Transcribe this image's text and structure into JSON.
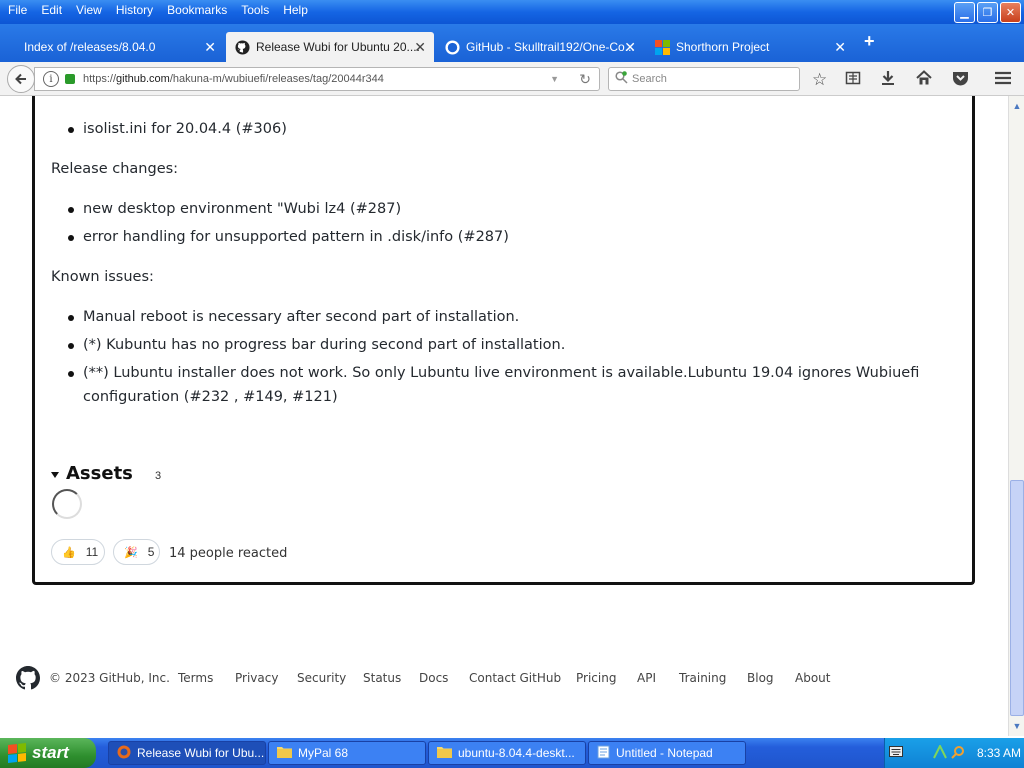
{
  "menu": [
    "File",
    "Edit",
    "View",
    "History",
    "Bookmarks",
    "Tools",
    "Help"
  ],
  "tabs": [
    {
      "title": "Index of /releases/8.04.0"
    },
    {
      "title": "Release Wubi for Ubuntu 20...."
    },
    {
      "title": "GitHub - Skulltrail192/One-Co..."
    },
    {
      "title": "Shorthorn Project"
    }
  ],
  "address": {
    "prefix": "https://",
    "domain": "github.com",
    "path": "/hakuna-m/wubiuefi/releases/tag/20044r344"
  },
  "search": {
    "placeholder": "Search"
  },
  "release": {
    "bullet_top": "isolist.ini for 20.04.4 (#306)",
    "changes_heading": "Release changes:",
    "changes": [
      "new desktop environment \"Wubi lz4 (#287)",
      "error handling for unsupported pattern in .disk/info (#287)"
    ],
    "issues_heading": "Known issues:",
    "issues": [
      "Manual reboot is necessary after second part of installation.",
      "(*) Kubuntu has no progress bar during second part of installation.",
      "(**) Lubuntu installer does not work. So only Lubuntu live environment is available.Lubuntu 19.04 ignores Wubiuefi",
      "configuration (#232 , #149, #121)"
    ]
  },
  "assets": {
    "title": "Assets",
    "count": "3"
  },
  "reactions": {
    "thumbs_count": "11",
    "hooray_count": "5",
    "summary": "14 people reacted"
  },
  "footer": {
    "copyright": "© 2023 GitHub, Inc.",
    "links": [
      "Terms",
      "Privacy",
      "Security",
      "Status",
      "Docs",
      "Contact GitHub",
      "Pricing",
      "API",
      "Training",
      "Blog",
      "About"
    ]
  },
  "taskbar": {
    "start": "start",
    "tasks": [
      "Release Wubi for Ubu...",
      "MyPal 68",
      "ubuntu-8.04.4-deskt...",
      "Untitled - Notepad"
    ],
    "clock": "8:33 AM"
  },
  "colors": {
    "titlebar": "#1565e4",
    "taskbar": "#245edb",
    "start": "#2e8f2e"
  }
}
